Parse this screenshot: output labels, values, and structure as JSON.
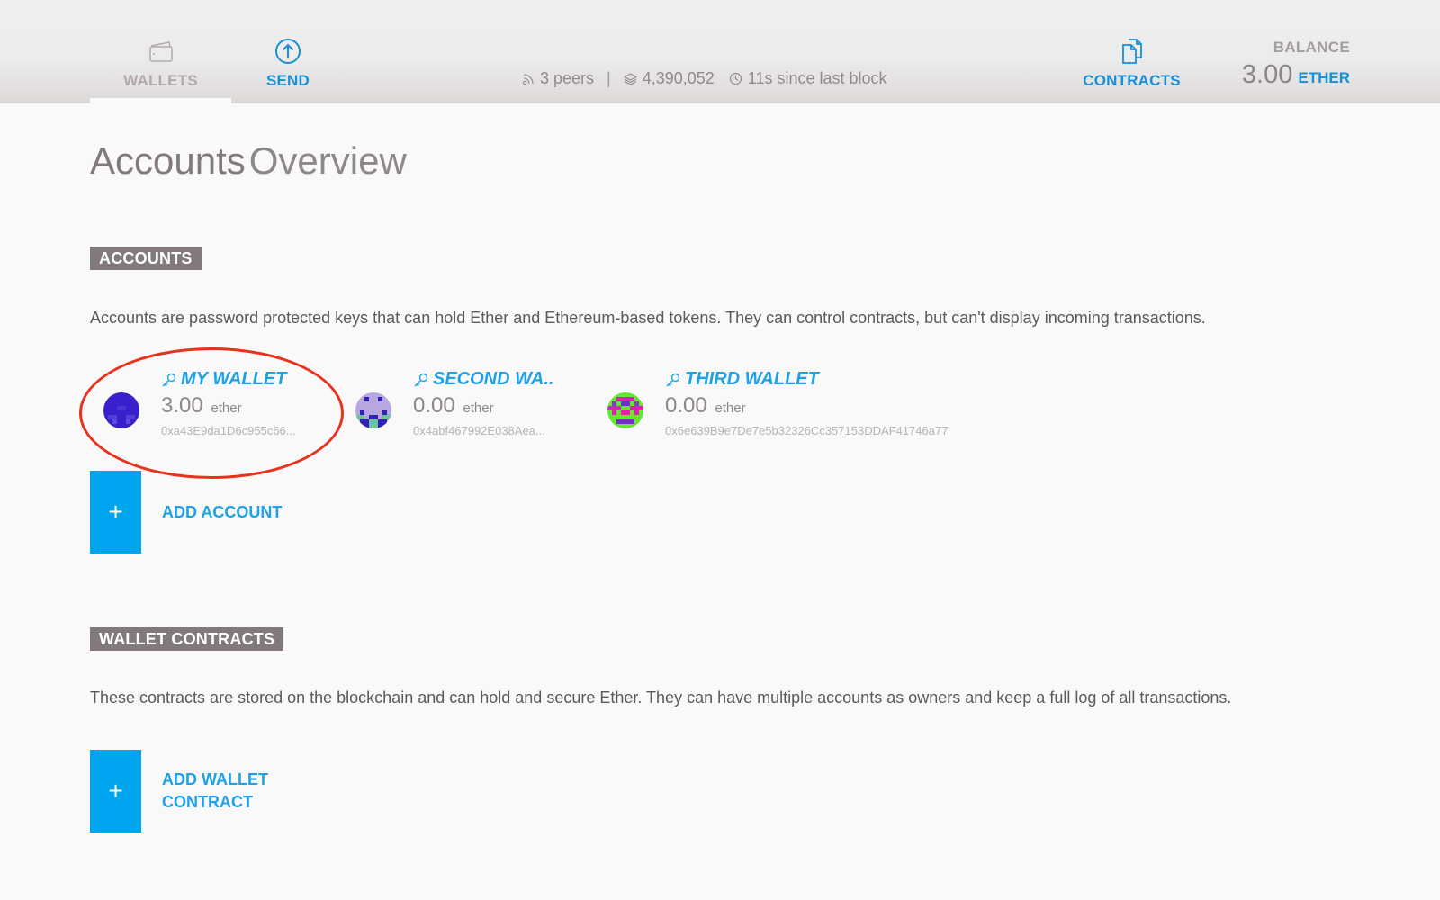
{
  "header": {
    "nav": {
      "wallets": {
        "label": "WALLETS",
        "icon": "wallet-icon"
      },
      "send": {
        "label": "SEND",
        "icon": "arrow-up-circle-icon"
      },
      "contracts": {
        "label": "CONTRACTS",
        "icon": "documents-icon"
      }
    },
    "status": {
      "peers": "3 peers",
      "separator": "|",
      "block_number": "4,390,052",
      "since_last_block": "11s since last block"
    },
    "balance": {
      "label": "BALANCE",
      "amount": "3.00",
      "unit": "ETHER"
    }
  },
  "page": {
    "title_bold": "Accounts",
    "title_light": "Overview"
  },
  "accounts_section": {
    "tag": "ACCOUNTS",
    "description": "Accounts are password protected keys that can hold Ether and Ethereum-based tokens. They can control contracts, but can't display incoming transactions.",
    "accounts": [
      {
        "name": "MY WALLET",
        "balance": "3.00",
        "unit": "ether",
        "address": "0xa43E9da1D6c955c66...",
        "highlighted": true
      },
      {
        "name": "SECOND WA..",
        "balance": "0.00",
        "unit": "ether",
        "address": "0x4abf467992E038Aea..."
      },
      {
        "name": "THIRD WALLET",
        "balance": "0.00",
        "unit": "ether",
        "address": "0x6e639B9e7De7e5b32326Cc357153DDAF41746a77"
      }
    ],
    "add_button": {
      "symbol": "+",
      "label": "ADD ACCOUNT"
    }
  },
  "contracts_section": {
    "tag": "WALLET CONTRACTS",
    "description": "These contracts are stored on the blockchain and can hold and secure Ether. They can have multiple accounts as owners and keep a full log of all transactions.",
    "add_button": {
      "symbol": "+",
      "label_line1": "ADD WALLET",
      "label_line2": "CONTRACT"
    }
  },
  "colors": {
    "accent": "#1ea1e6",
    "add_button": "#01a4ee",
    "tag_background": "#827a7a",
    "highlight": "#e8321c"
  }
}
